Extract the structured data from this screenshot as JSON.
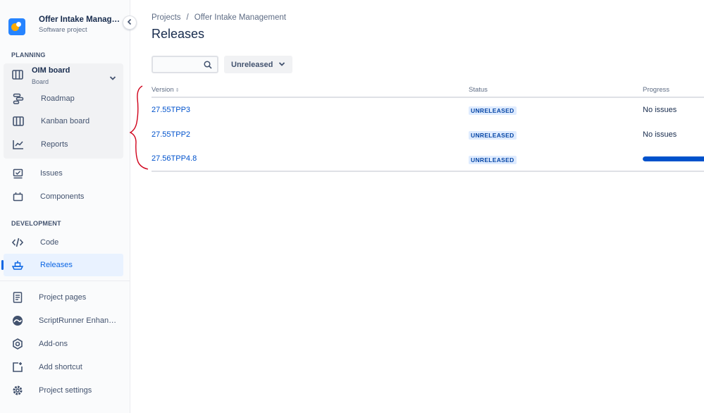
{
  "project": {
    "name": "Offer Intake Management",
    "type": "Software project"
  },
  "sidebar": {
    "planning_label": "PLANNING",
    "board": {
      "title": "OIM board",
      "subtitle": "Board"
    },
    "planning_items": [
      {
        "label": "Roadmap",
        "icon": "roadmap-icon"
      },
      {
        "label": "Kanban board",
        "icon": "kanban-board-icon"
      },
      {
        "label": "Reports",
        "icon": "reports-icon"
      }
    ],
    "other_items": [
      {
        "label": "Issues",
        "icon": "issues-icon"
      },
      {
        "label": "Components",
        "icon": "components-icon"
      }
    ],
    "development_label": "DEVELOPMENT",
    "development_items": [
      {
        "label": "Code",
        "icon": "code-icon"
      },
      {
        "label": "Releases",
        "icon": "releases-icon",
        "active": true
      }
    ],
    "footer_items": [
      {
        "label": "Project pages",
        "icon": "project-pages-icon"
      },
      {
        "label": "ScriptRunner Enhanced Search",
        "icon": "scriptrunner-icon"
      },
      {
        "label": "Add-ons",
        "icon": "add-ons-icon"
      },
      {
        "label": "Add shortcut",
        "icon": "add-shortcut-icon"
      },
      {
        "label": "Project settings",
        "icon": "project-settings-icon"
      }
    ]
  },
  "breadcrumb": {
    "items": [
      "Projects",
      "Offer Intake Management"
    ],
    "separator": "/"
  },
  "page_title": "Releases",
  "filters": {
    "search_value": "",
    "status_filter": "Unreleased"
  },
  "table": {
    "columns": [
      "Version",
      "Status",
      "Progress"
    ],
    "rows": [
      {
        "version": "27.55TPP3",
        "status": "UNRELEASED",
        "progress_text": "No issues"
      },
      {
        "version": "27.55TPP2",
        "status": "UNRELEASED",
        "progress_text": "No issues"
      },
      {
        "version": "27.56TPP4.8",
        "status": "UNRELEASED",
        "progress_text": "",
        "progress_fraction": 1.0
      }
    ]
  },
  "colors": {
    "accent": "#0052cc",
    "active_nav_bg": "#e9f2ff",
    "badge_bg": "#deebff",
    "annotation": "#d0021b"
  }
}
